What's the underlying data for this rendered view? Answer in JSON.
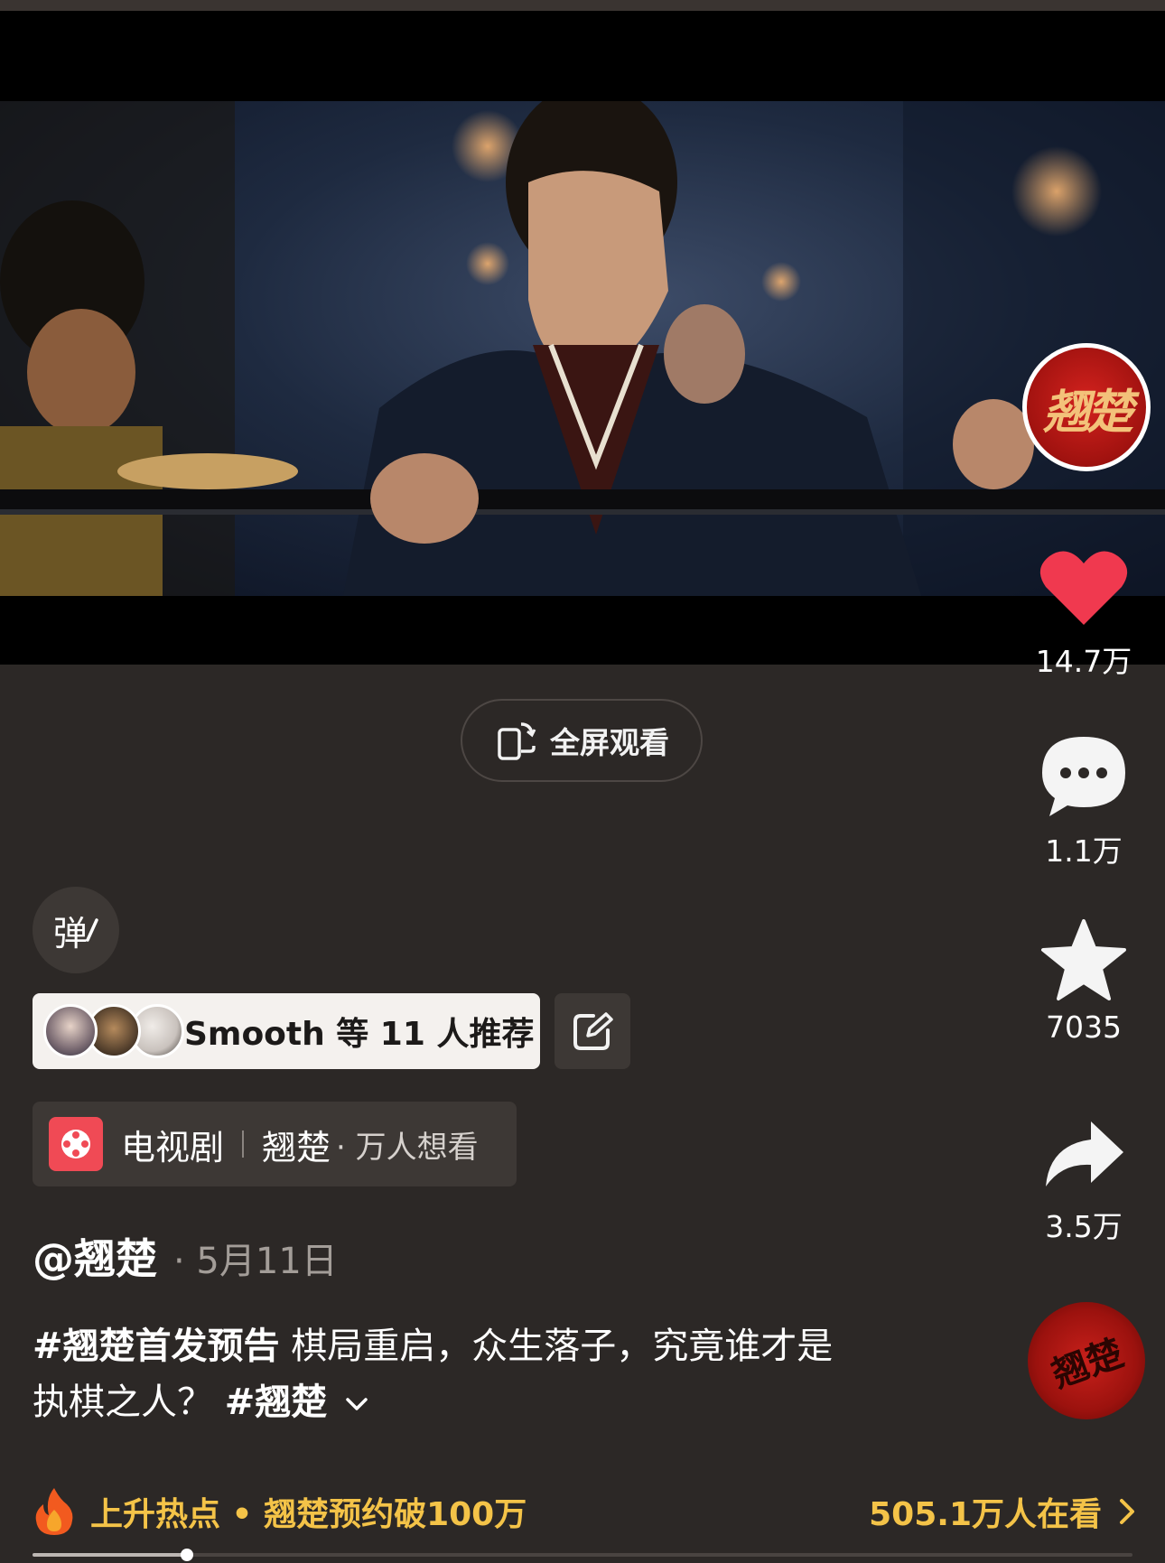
{
  "video": {
    "fullscreen_label": "全屏观看"
  },
  "creator": {
    "avatar_seal": "翘楚"
  },
  "actions": {
    "likes": "14.7万",
    "comments": "1.1万",
    "favorites": "7035",
    "shares": "3.5万"
  },
  "danmu": {
    "label": "弹"
  },
  "recommend": {
    "text": "Smooth 等 11 人推荐"
  },
  "drama": {
    "type": "电视剧",
    "name": "翘楚",
    "meta": "· 万人想看"
  },
  "post": {
    "author": "@翘楚",
    "date": "· 5月11日",
    "caption_tag": "#翘楚首发预告",
    "caption_line1_rest": " 棋局重启，众生落子，究竟谁才是",
    "caption_line2": "执棋之人？",
    "caption_tag2": "#翘楚"
  },
  "music": {
    "disc_seal": "翘楚"
  },
  "hot": {
    "text": "上升热点 • 翘楚预约破100万",
    "watching": "505.1万人在看"
  },
  "playback": {
    "progress": 0.14
  },
  "colors": {
    "like": "#f0394f",
    "hot": "#f4c348",
    "background": "#2c2826"
  }
}
